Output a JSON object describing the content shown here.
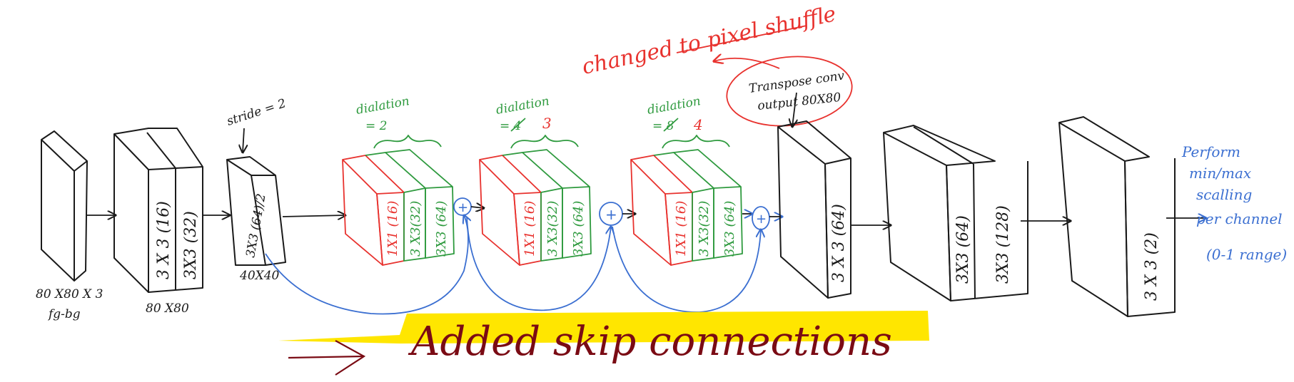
{
  "colors": {
    "ink": "#1a1a1a",
    "red": "#e8322e",
    "green": "#2e9a3e",
    "blue": "#3b6fd1",
    "highlight": "#ffe600",
    "maroon": "#7a0b14"
  },
  "input": {
    "line1": "80 X80 X 3",
    "line2": "fg-bg"
  },
  "block1": {
    "layer_a": "3 X 3 (16)",
    "layer_b": "3X3 (32)",
    "size": "80 X80"
  },
  "block2": {
    "stride_note": "stride = 2",
    "layer": "3X3 (64)/2",
    "size": "40X40"
  },
  "dil_block_1": {
    "label_line1": "dialation",
    "label_line2": "= 2",
    "layers": [
      "1X1 (16)",
      "3 X3(32)",
      "3X3 (64)"
    ]
  },
  "dil_block_2": {
    "label_line1": "dialation",
    "label_old": "= 4",
    "label_new": "3",
    "layers": [
      "1X1 (16)",
      "3 X3(32)",
      "3X3 (64)"
    ]
  },
  "dil_block_3": {
    "label_line1": "dialation",
    "label_old": "= 8",
    "label_new": "4",
    "layers": [
      "1X1 (16)",
      "3 X3(32)",
      "3X3 (64)"
    ]
  },
  "plus_symbol": "+",
  "transpose_note": {
    "line1": "Transpose conv",
    "line2": "output 80X80"
  },
  "pixel_shuffle_note": "changed to pixel shuffle",
  "block_t": {
    "layer": "3 X 3 (64)"
  },
  "block4": {
    "layer_a": "3X3 (64)",
    "layer_b": "3X3 (128)"
  },
  "block5": {
    "layer": "3 X 3 (2)"
  },
  "scaling_note": [
    "Perform",
    "min/max",
    "scalling",
    "per channel",
    "(0-1 range)"
  ],
  "skip_note": "Added skip connections"
}
